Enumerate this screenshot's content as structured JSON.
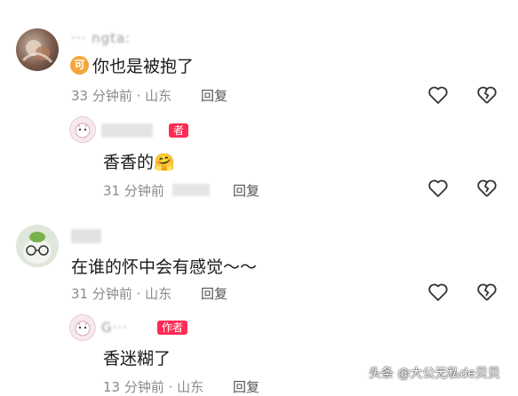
{
  "comments": [
    {
      "nickname": "··· ngta:",
      "badge_icon": "可",
      "text": "你也是被抱了",
      "meta": "33 分钟前 · 山东",
      "reply_label": "回复",
      "reply": {
        "author_tag": "者",
        "text": "香香的",
        "emoji": "🤗",
        "meta": "31 分钟前",
        "reply_label": "回复"
      }
    },
    {
      "text": "在谁的怀中会有感觉～～",
      "meta": "31 分钟前 · 山东",
      "reply_label": "回复",
      "reply": {
        "nickname": "G···",
        "author_tag": "作者",
        "text": "香迷糊了",
        "meta": "13 分钟前 · 山东",
        "reply_label": "回复"
      }
    }
  ],
  "watermark": "头条 @大公无私de贝贝",
  "colors": {
    "accent": "#fe2c55",
    "badge": "#f4a63a",
    "meta": "#8a8a8a"
  },
  "icons": [
    "heart-outline-icon",
    "broken-heart-icon"
  ]
}
